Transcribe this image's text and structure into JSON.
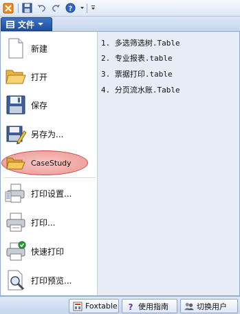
{
  "quick_access": {
    "icons": [
      "app-icon",
      "save-icon",
      "undo-icon",
      "redo-icon",
      "help-icon",
      "customize-dropdown-icon"
    ]
  },
  "file_menu": {
    "label": "文件"
  },
  "menu_items": [
    {
      "label": "新建",
      "icon": "new-document-icon"
    },
    {
      "label": "打开",
      "icon": "open-folder-icon"
    },
    {
      "label": "保存",
      "icon": "save-icon"
    },
    {
      "label": "另存为...",
      "icon": "save-as-icon"
    },
    {
      "label": "CaseStudy",
      "icon": "folder-icon",
      "highlight_color": "#ef9f9c"
    },
    {
      "label": "打印设置...",
      "icon": "print-setup-icon"
    },
    {
      "label": "打印...",
      "icon": "print-icon"
    },
    {
      "label": "快速打印",
      "icon": "quick-print-icon"
    },
    {
      "label": "打印预览...",
      "icon": "print-preview-icon"
    }
  ],
  "recent_files": [
    "1. 多选筛选树.Table",
    "2. 专业报表.table",
    "3. 票据打印.table",
    "4. 分页流水账.Table"
  ],
  "bottom_buttons": [
    {
      "label": "Foxtable",
      "icon": "foxtable-icon"
    },
    {
      "label": "使用指南",
      "icon": "question-icon"
    },
    {
      "label": "切换用户",
      "icon": "users-icon"
    }
  ],
  "colors": {
    "file_button": "#2b5fb1",
    "recent_panel": "#e6edf7",
    "highlight": "#ef9f9c"
  }
}
